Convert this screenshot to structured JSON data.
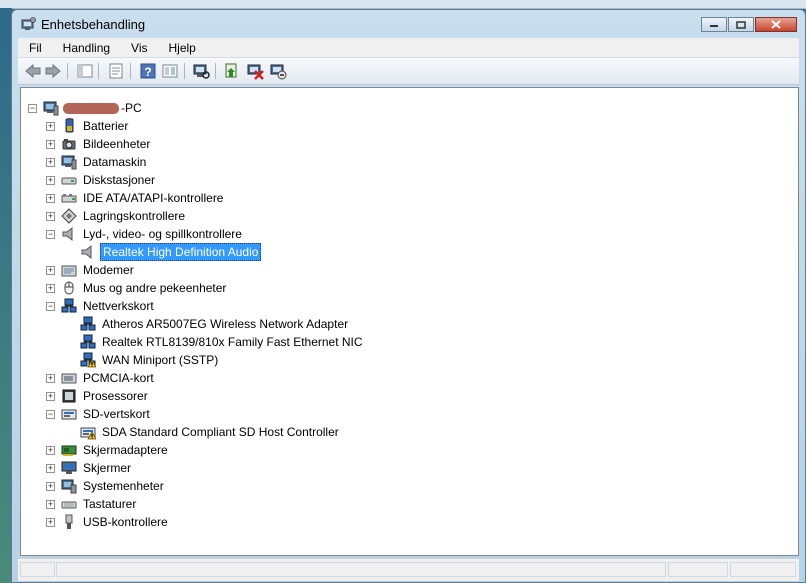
{
  "window": {
    "title": "Enhetsbehandling"
  },
  "menu": [
    "Fil",
    "Handling",
    "Vis",
    "Hjelp"
  ],
  "toolbar": [
    "back-icon",
    "forward-icon",
    "console-tree-icon",
    "properties-icon",
    "help-icon",
    "view-icon",
    "scan-hardware-icon",
    "update-driver-icon",
    "disable-device-icon",
    "uninstall-device-icon"
  ],
  "tree": {
    "root": {
      "label": "-PC",
      "expanded": true
    },
    "categories": [
      {
        "label": "Batterier",
        "expanded": false,
        "icon": "battery-icon",
        "children": []
      },
      {
        "label": "Bildeenheter",
        "expanded": false,
        "icon": "camera-icon",
        "children": []
      },
      {
        "label": "Datamaskin",
        "expanded": false,
        "icon": "computer-icon",
        "children": []
      },
      {
        "label": "Diskstasjoner",
        "expanded": false,
        "icon": "disk-drive-icon",
        "children": []
      },
      {
        "label": "IDE ATA/ATAPI-kontrollere",
        "expanded": false,
        "icon": "ide-controller-icon",
        "children": []
      },
      {
        "label": "Lagringskontrollere",
        "expanded": false,
        "icon": "storage-controller-icon",
        "children": []
      },
      {
        "label": "Lyd-, video- og spillkontrollere",
        "expanded": true,
        "icon": "speaker-icon",
        "children": [
          {
            "label": "Realtek High Definition Audio",
            "icon": "speaker-icon",
            "selected": true,
            "warning": false
          }
        ]
      },
      {
        "label": "Modemer",
        "expanded": false,
        "icon": "modem-icon",
        "children": []
      },
      {
        "label": "Mus og andre pekeenheter",
        "expanded": false,
        "icon": "mouse-icon",
        "children": []
      },
      {
        "label": "Nettverkskort",
        "expanded": true,
        "icon": "network-adapter-icon",
        "children": [
          {
            "label": "Atheros AR5007EG Wireless Network Adapter",
            "icon": "network-adapter-icon",
            "warning": false
          },
          {
            "label": "Realtek RTL8139/810x Family Fast Ethernet NIC",
            "icon": "network-adapter-icon",
            "warning": false
          },
          {
            "label": "WAN Miniport (SSTP)",
            "icon": "network-adapter-icon",
            "warning": true
          }
        ]
      },
      {
        "label": "PCMCIA-kort",
        "expanded": false,
        "icon": "pcmcia-icon",
        "children": []
      },
      {
        "label": "Prosessorer",
        "expanded": false,
        "icon": "processor-icon",
        "children": []
      },
      {
        "label": "SD-vertskort",
        "expanded": true,
        "icon": "sd-host-icon",
        "children": [
          {
            "label": "SDA Standard Compliant SD Host Controller",
            "icon": "sd-host-icon",
            "warning": true
          }
        ]
      },
      {
        "label": "Skjermadaptere",
        "expanded": false,
        "icon": "display-adapter-icon",
        "children": []
      },
      {
        "label": "Skjermer",
        "expanded": false,
        "icon": "monitor-icon",
        "children": []
      },
      {
        "label": "Systemenheter",
        "expanded": false,
        "icon": "system-device-icon",
        "children": []
      },
      {
        "label": "Tastaturer",
        "expanded": false,
        "icon": "keyboard-icon",
        "children": []
      },
      {
        "label": "USB-kontrollere",
        "expanded": false,
        "icon": "usb-icon",
        "children": []
      }
    ]
  },
  "colors": {
    "selection": "#3399ff",
    "warning": "#f2c200",
    "titlebar": "#c9dfee"
  }
}
